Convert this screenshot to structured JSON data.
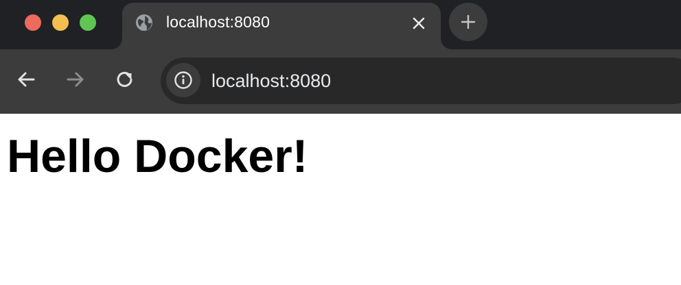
{
  "window": {
    "controls": [
      "close",
      "minimize",
      "zoom"
    ],
    "colors": {
      "close": "#ed6a5e",
      "minimize": "#f5bf4f",
      "zoom": "#61c554"
    }
  },
  "tabs": [
    {
      "title": "localhost:8080",
      "favicon": "globe-icon",
      "active": true
    }
  ],
  "toolbar": {
    "back_icon": "arrow-left-icon",
    "forward_icon": "arrow-right-icon",
    "reload_icon": "reload-icon",
    "site_info_icon": "info-icon",
    "url": "localhost:8080"
  },
  "page": {
    "heading": "Hello Docker!"
  }
}
